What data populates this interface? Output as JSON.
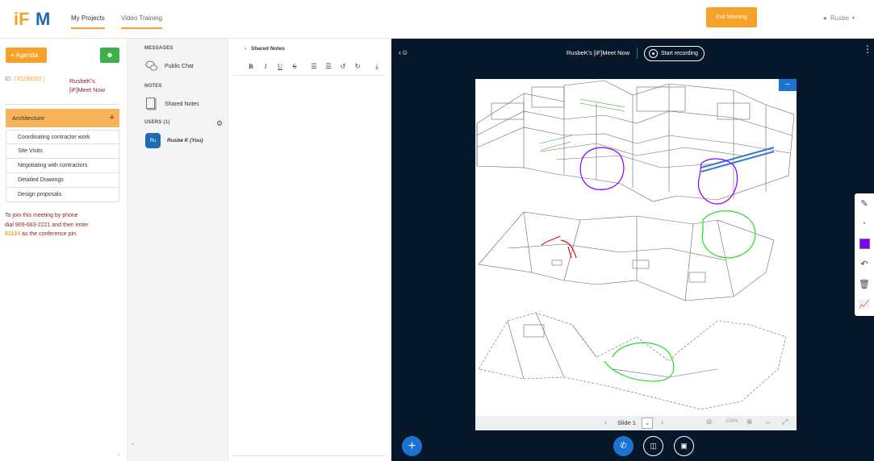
{
  "top_nav": {
    "logo_text": "iFM",
    "tabs": [
      {
        "label": "My Projects",
        "active": true
      },
      {
        "label": "Video Training",
        "active": false
      }
    ],
    "exit_label": "Exit Meeting",
    "user_name": "Rusbe"
  },
  "agenda": {
    "agenda_button": "+ Agenda",
    "meeting_id_prefix": "ID:",
    "meeting_id": "735290282 |",
    "meeting_name": "RusbeK's [iF]Meet Now",
    "section_title": "Architecture",
    "items": [
      "Coordinating contractor work",
      "Site Visits",
      "Negotiating with contractors",
      "Detailed Drawings",
      "Design proposals"
    ],
    "phone_line1": "To join this meeting by phone",
    "phone_line2": "dial 909-683-2221 and then enter",
    "pin": "91124",
    "phone_line3": "as the conference pin."
  },
  "chat_panel": {
    "messages_heading": "MESSAGES",
    "public_chat": "Public Chat",
    "notes_heading": "NOTES",
    "shared_notes": "Shared Notes",
    "users_heading": "USERS (1)",
    "users": [
      {
        "initials": "Ru",
        "name": "Rusbe K (You)"
      }
    ]
  },
  "notes_panel": {
    "title": "Shared Notes",
    "toolbar": [
      "B",
      "I",
      "U",
      "S",
      "ordered-list",
      "bullet-list",
      "undo",
      "redo",
      "export"
    ]
  },
  "presentation": {
    "title": "RusbeK's [iF]Meet Now",
    "record_label": "Start recording",
    "slide_label": "Slide 1",
    "zoom": "100%",
    "selected_color": "#8000ff"
  },
  "colors": {
    "accent": "#f7a129",
    "success": "#3fae4b",
    "primary": "#1c73d2",
    "presentation_bg": "#06172a"
  }
}
